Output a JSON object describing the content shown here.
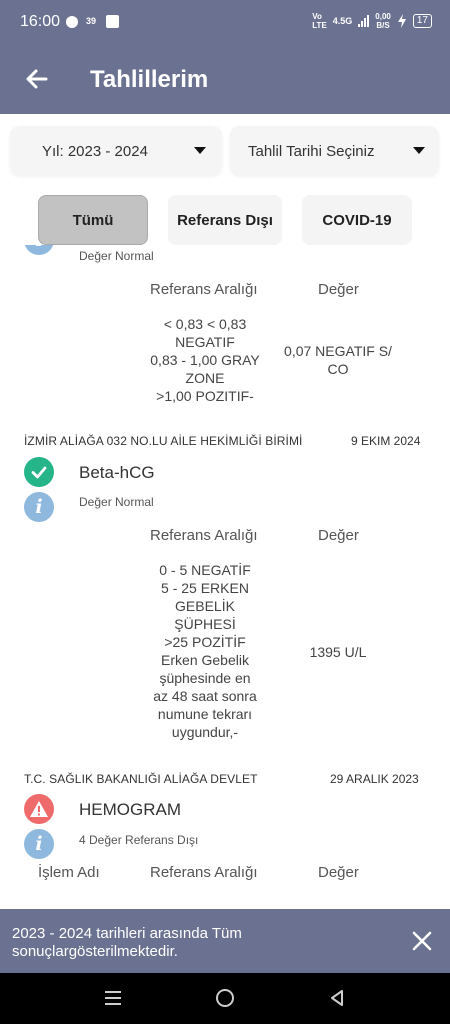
{
  "status_bar": {
    "time": "16:00",
    "badge": "39",
    "network_left": "Vo\nLTE",
    "network_gen": "4.5G",
    "speed_value": "0,00",
    "speed_unit": "B/S",
    "battery": "17"
  },
  "app_bar": {
    "title": "Tahlillerim"
  },
  "filters": {
    "year_label": "Yıl: 2023 - 2024",
    "date_label": "Tahlil Tarihi Seçiniz"
  },
  "tabs": [
    {
      "label": "Tümü"
    },
    {
      "label": "Referans Dışı"
    },
    {
      "label": "COVID-19"
    }
  ],
  "results": [
    {
      "status_text": "Değer Normal",
      "ref_header": "Referans Aralığı",
      "value_header": "Değer",
      "ref_lines": [
        "< 0,83 < 0,83",
        "NEGATIF",
        "0,83 - 1,00 GRAY",
        "ZONE",
        ">1,00 POZITIF-"
      ],
      "value_lines": [
        "0,07 NEGATIF S/",
        "CO"
      ]
    },
    {
      "lab": "İZMİR ALİAĞA 032 NO.LU AİLE HEKİMLİĞİ BİRİMİ",
      "date": "9 EKIM 2024",
      "name": "Beta-hCG",
      "status_text": "Değer Normal",
      "ref_header": "Referans Aralığı",
      "value_header": "Değer",
      "ref_lines": [
        "0 - 5  NEGATİF",
        "5 - 25 ERKEN",
        "GEBELİK",
        "ŞÜPHESİ",
        ">25    POZİTİF",
        "Erken Gebelik",
        "şüphesinde en",
        "az 48 saat sonra",
        "numune tekrarı",
        "uygundur,-"
      ],
      "value": "1395 U/L"
    },
    {
      "lab": "T.C. SAĞLIK BAKANLIĞI ALİAĞA DEVLET",
      "date": "29 ARALIK 2023",
      "name": "HEMOGRAM",
      "status_text": "4 Değer Referans Dışı",
      "name_header": "İşlem Adı",
      "ref_header": "Referans Aralığı",
      "value_header": "Değer"
    }
  ],
  "snackbar": {
    "message": "2023 - 2024 tarihleri arasında Tüm sonuçlargösterilmektedir."
  },
  "icons": {
    "back": "arrow-left-icon",
    "check": "check-icon",
    "info": "info-icon",
    "warning": "warning-icon",
    "close": "close-icon"
  },
  "colors": {
    "primary": "#6b7291",
    "success": "#26b489",
    "info": "#8fb8df",
    "danger": "#ef6b6b"
  }
}
